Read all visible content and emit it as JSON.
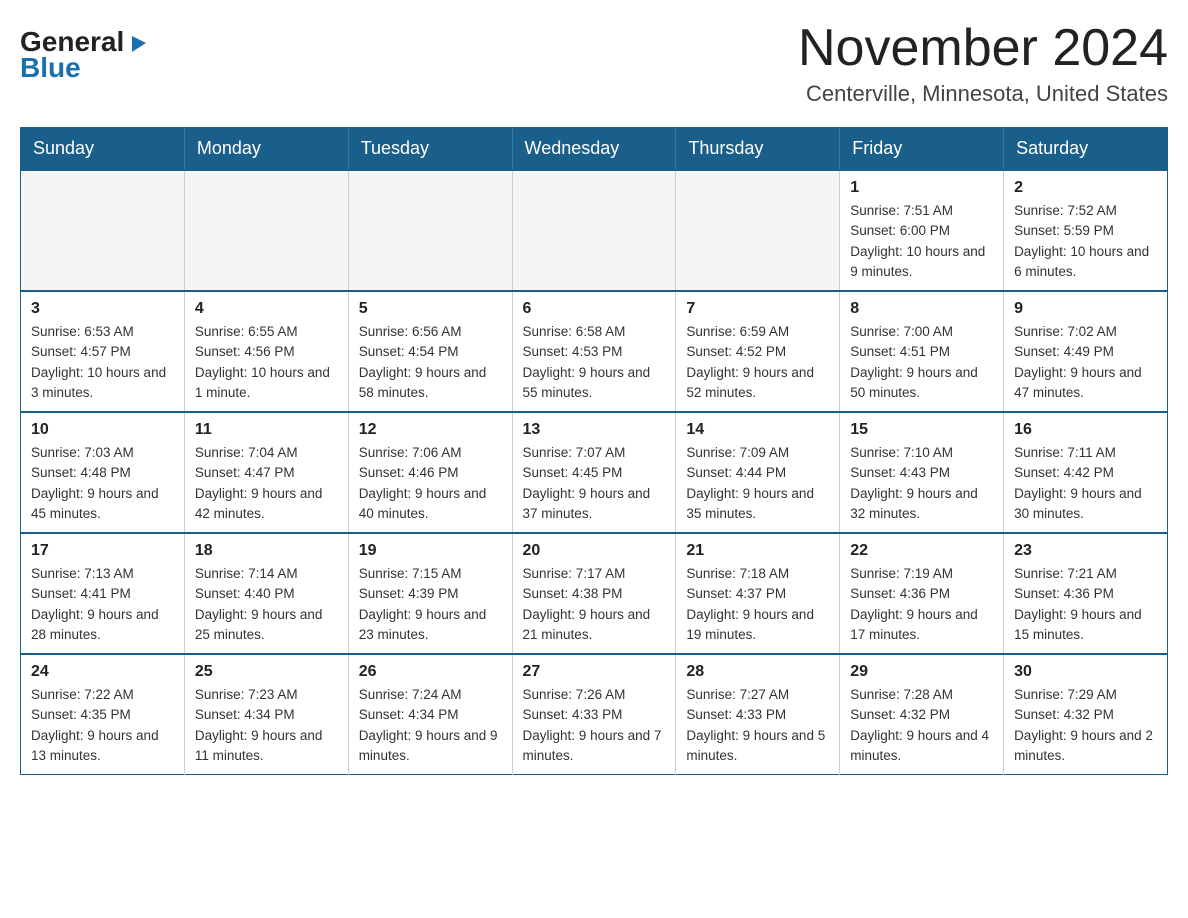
{
  "header": {
    "logo": {
      "general": "General",
      "blue": "Blue",
      "triangle": "▶"
    },
    "title": "November 2024",
    "location": "Centerville, Minnesota, United States"
  },
  "calendar": {
    "days_of_week": [
      "Sunday",
      "Monday",
      "Tuesday",
      "Wednesday",
      "Thursday",
      "Friday",
      "Saturday"
    ],
    "weeks": [
      [
        {
          "day": "",
          "info": ""
        },
        {
          "day": "",
          "info": ""
        },
        {
          "day": "",
          "info": ""
        },
        {
          "day": "",
          "info": ""
        },
        {
          "day": "",
          "info": ""
        },
        {
          "day": "1",
          "info": "Sunrise: 7:51 AM\nSunset: 6:00 PM\nDaylight: 10 hours and 9 minutes."
        },
        {
          "day": "2",
          "info": "Sunrise: 7:52 AM\nSunset: 5:59 PM\nDaylight: 10 hours and 6 minutes."
        }
      ],
      [
        {
          "day": "3",
          "info": "Sunrise: 6:53 AM\nSunset: 4:57 PM\nDaylight: 10 hours and 3 minutes."
        },
        {
          "day": "4",
          "info": "Sunrise: 6:55 AM\nSunset: 4:56 PM\nDaylight: 10 hours and 1 minute."
        },
        {
          "day": "5",
          "info": "Sunrise: 6:56 AM\nSunset: 4:54 PM\nDaylight: 9 hours and 58 minutes."
        },
        {
          "day": "6",
          "info": "Sunrise: 6:58 AM\nSunset: 4:53 PM\nDaylight: 9 hours and 55 minutes."
        },
        {
          "day": "7",
          "info": "Sunrise: 6:59 AM\nSunset: 4:52 PM\nDaylight: 9 hours and 52 minutes."
        },
        {
          "day": "8",
          "info": "Sunrise: 7:00 AM\nSunset: 4:51 PM\nDaylight: 9 hours and 50 minutes."
        },
        {
          "day": "9",
          "info": "Sunrise: 7:02 AM\nSunset: 4:49 PM\nDaylight: 9 hours and 47 minutes."
        }
      ],
      [
        {
          "day": "10",
          "info": "Sunrise: 7:03 AM\nSunset: 4:48 PM\nDaylight: 9 hours and 45 minutes."
        },
        {
          "day": "11",
          "info": "Sunrise: 7:04 AM\nSunset: 4:47 PM\nDaylight: 9 hours and 42 minutes."
        },
        {
          "day": "12",
          "info": "Sunrise: 7:06 AM\nSunset: 4:46 PM\nDaylight: 9 hours and 40 minutes."
        },
        {
          "day": "13",
          "info": "Sunrise: 7:07 AM\nSunset: 4:45 PM\nDaylight: 9 hours and 37 minutes."
        },
        {
          "day": "14",
          "info": "Sunrise: 7:09 AM\nSunset: 4:44 PM\nDaylight: 9 hours and 35 minutes."
        },
        {
          "day": "15",
          "info": "Sunrise: 7:10 AM\nSunset: 4:43 PM\nDaylight: 9 hours and 32 minutes."
        },
        {
          "day": "16",
          "info": "Sunrise: 7:11 AM\nSunset: 4:42 PM\nDaylight: 9 hours and 30 minutes."
        }
      ],
      [
        {
          "day": "17",
          "info": "Sunrise: 7:13 AM\nSunset: 4:41 PM\nDaylight: 9 hours and 28 minutes."
        },
        {
          "day": "18",
          "info": "Sunrise: 7:14 AM\nSunset: 4:40 PM\nDaylight: 9 hours and 25 minutes."
        },
        {
          "day": "19",
          "info": "Sunrise: 7:15 AM\nSunset: 4:39 PM\nDaylight: 9 hours and 23 minutes."
        },
        {
          "day": "20",
          "info": "Sunrise: 7:17 AM\nSunset: 4:38 PM\nDaylight: 9 hours and 21 minutes."
        },
        {
          "day": "21",
          "info": "Sunrise: 7:18 AM\nSunset: 4:37 PM\nDaylight: 9 hours and 19 minutes."
        },
        {
          "day": "22",
          "info": "Sunrise: 7:19 AM\nSunset: 4:36 PM\nDaylight: 9 hours and 17 minutes."
        },
        {
          "day": "23",
          "info": "Sunrise: 7:21 AM\nSunset: 4:36 PM\nDaylight: 9 hours and 15 minutes."
        }
      ],
      [
        {
          "day": "24",
          "info": "Sunrise: 7:22 AM\nSunset: 4:35 PM\nDaylight: 9 hours and 13 minutes."
        },
        {
          "day": "25",
          "info": "Sunrise: 7:23 AM\nSunset: 4:34 PM\nDaylight: 9 hours and 11 minutes."
        },
        {
          "day": "26",
          "info": "Sunrise: 7:24 AM\nSunset: 4:34 PM\nDaylight: 9 hours and 9 minutes."
        },
        {
          "day": "27",
          "info": "Sunrise: 7:26 AM\nSunset: 4:33 PM\nDaylight: 9 hours and 7 minutes."
        },
        {
          "day": "28",
          "info": "Sunrise: 7:27 AM\nSunset: 4:33 PM\nDaylight: 9 hours and 5 minutes."
        },
        {
          "day": "29",
          "info": "Sunrise: 7:28 AM\nSunset: 4:32 PM\nDaylight: 9 hours and 4 minutes."
        },
        {
          "day": "30",
          "info": "Sunrise: 7:29 AM\nSunset: 4:32 PM\nDaylight: 9 hours and 2 minutes."
        }
      ]
    ]
  }
}
